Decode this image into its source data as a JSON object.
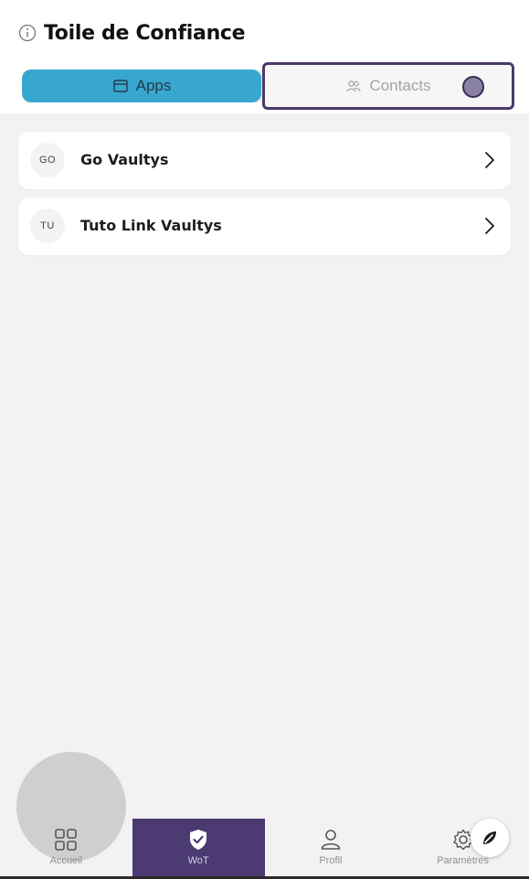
{
  "header": {
    "title": "Toile de Confiance",
    "info_icon": "info-icon"
  },
  "tabs": [
    {
      "label": "Apps",
      "icon": "window-icon",
      "selected": true
    },
    {
      "label": "Contacts",
      "icon": "users-icon",
      "selected": false
    }
  ],
  "apps": [
    {
      "initials": "GO",
      "name": "Go Vaultys"
    },
    {
      "initials": "TU",
      "name": "Tuto Link Vaultys"
    }
  ],
  "bottom_nav": [
    {
      "label": "Accueil",
      "icon": "grid-icon",
      "active": false
    },
    {
      "label": "WoT",
      "icon": "shield-check-icon",
      "active": true
    },
    {
      "label": "Profil",
      "icon": "user-icon",
      "active": false
    },
    {
      "label": "Paramètres",
      "icon": "gear-icon",
      "active": false
    }
  ],
  "colors": {
    "accent_blue": "#38a7cf",
    "brand_purple": "#4c3a73",
    "background": "#f2f2f3"
  }
}
